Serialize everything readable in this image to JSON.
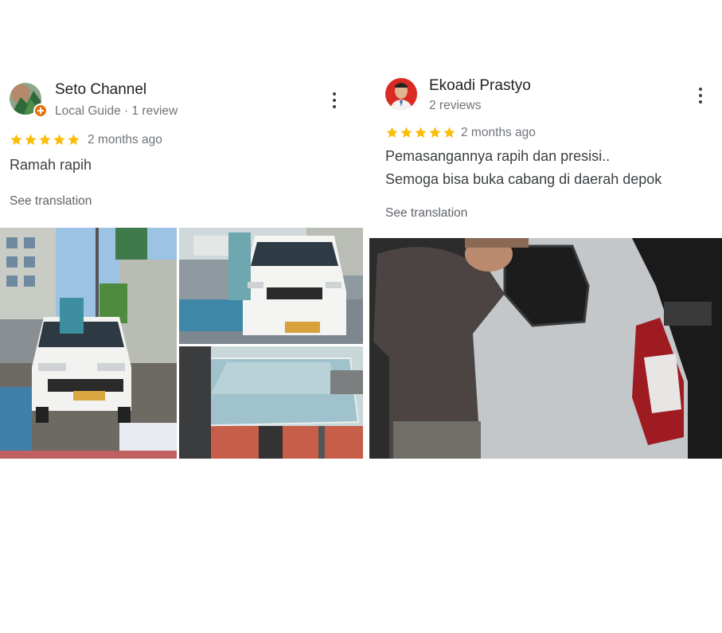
{
  "reviews": [
    {
      "author": "Seto Channel",
      "meta": "Local Guide · 1 review",
      "rating": 5,
      "time": "2 months ago",
      "text_lines": [
        "Ramah rapih"
      ],
      "see_translation": "See translation",
      "photos": [
        "car-on-street-photo",
        "car-front-photo",
        "glass-windshield-photo"
      ]
    },
    {
      "author": "Ekoadi Prastyo",
      "meta": "2 reviews",
      "rating": 5,
      "time": "2 months ago",
      "text_lines": [
        "Pemasangannya rapih dan presisi..",
        "Semoga bisa buka cabang di daerah depok"
      ],
      "see_translation": "See translation",
      "photos": [
        "window-installation-photo"
      ]
    }
  ],
  "colors": {
    "star": "#fbbc04",
    "local_guide_badge": "#e8710a",
    "secondary_text": "#70757a"
  },
  "icons": {
    "menu": "more-vert-icon",
    "star": "star-icon"
  }
}
